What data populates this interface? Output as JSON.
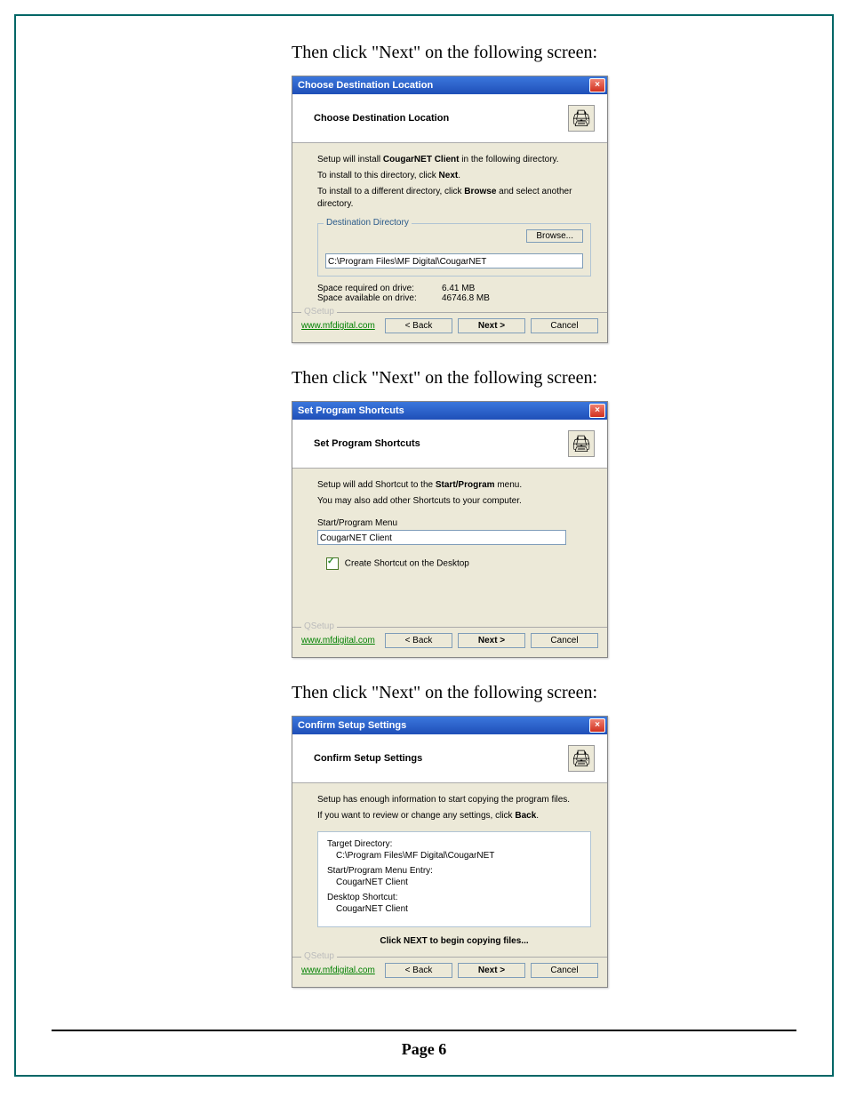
{
  "captions": {
    "c1": "Then click \"Next\" on the following screen:",
    "c2": "Then click \"Next\" on the following screen:",
    "c3": "Then click \"Next\" on the following screen:"
  },
  "common": {
    "qsetup": "QSetup",
    "link": "www.mfdigital.com",
    "back": "< Back",
    "next": "Next >",
    "cancel": "Cancel",
    "headerIconGlyph": "🖨"
  },
  "dialog1": {
    "title": "Choose Destination Location",
    "header": "Choose Destination Location",
    "line1a": "Setup will install ",
    "line1b": "CougarNET Client",
    "line1c": " in the following directory.",
    "line2a": "To install to this directory, click ",
    "line2b": "Next",
    "line2c": ".",
    "line3a": "To install to a different directory, click ",
    "line3b": "Browse",
    "line3c": " and select another directory.",
    "legend": "Destination Directory",
    "browse": "Browse...",
    "path": "C:\\Program Files\\MF Digital\\CougarNET",
    "spaceReqLabel": "Space required on drive:",
    "spaceReqVal": "6.41 MB",
    "spaceAvailLabel": "Space available on drive:",
    "spaceAvailVal": "46746.8 MB"
  },
  "dialog2": {
    "title": "Set Program Shortcuts",
    "header": "Set Program Shortcuts",
    "line1a": "Setup will add Shortcut to the ",
    "line1b": "Start/Program",
    "line1c": " menu.",
    "line2": "You may also add other Shortcuts to your computer.",
    "menuLabel": "Start/Program Menu",
    "menuValue": "CougarNET Client",
    "cbLabel": "Create Shortcut on the Desktop"
  },
  "dialog3": {
    "title": "Confirm Setup Settings",
    "header": "Confirm Setup Settings",
    "line1": "Setup has enough information to start copying the program files.",
    "line2a": "If you want to review or change any settings, click ",
    "line2b": "Back",
    "line2c": ".",
    "targetLabel": "Target Directory:",
    "targetVal": "C:\\Program Files\\MF Digital\\CougarNET",
    "menuLabel": "Start/Program Menu Entry:",
    "menuVal": "CougarNET Client",
    "deskLabel": "Desktop Shortcut:",
    "deskVal": "CougarNET Client",
    "clickNext": "Click NEXT to begin copying files..."
  },
  "pageNum": "Page 6"
}
